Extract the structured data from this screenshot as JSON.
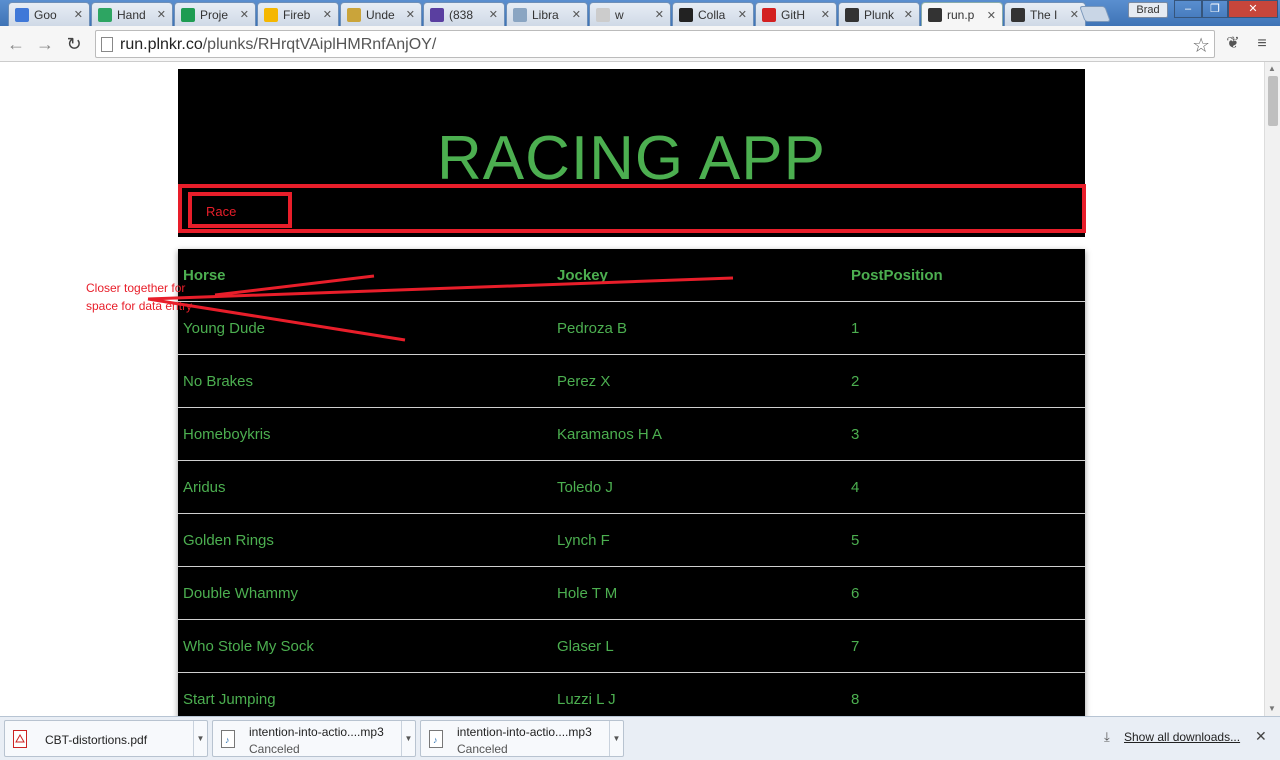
{
  "browser": {
    "tabs": [
      {
        "label": "Goo",
        "color": "#3f78d8"
      },
      {
        "label": "Hand",
        "color": "#2da562"
      },
      {
        "label": "Proje",
        "color": "#1e9c52"
      },
      {
        "label": "Fireb",
        "color": "#f5b700"
      },
      {
        "label": "Unde",
        "color": "#caa43a"
      },
      {
        "label": "(838",
        "color": "#5a3fa0"
      },
      {
        "label": "Libra",
        "color": "#8aa5c2"
      },
      {
        "label": "w",
        "color": "#cccccc"
      },
      {
        "label": "Colla",
        "color": "#222222"
      },
      {
        "label": "GitH",
        "color": "#d32020"
      },
      {
        "label": "Plunk",
        "color": "#333333"
      },
      {
        "label": "run.p",
        "color": "#333333"
      },
      {
        "label": "The I",
        "color": "#333333"
      }
    ],
    "user": "Brad",
    "url_host": "run.plnkr.co",
    "url_path": "/plunks/RHrqtVAiplHMRnfAnjOY/"
  },
  "page": {
    "title": "RACING APP",
    "nav": {
      "race_label": "Race"
    },
    "table": {
      "headers": [
        "Horse",
        "Jockey",
        "PostPosition"
      ],
      "rows": [
        [
          "Young Dude",
          "Pedroza B",
          "1"
        ],
        [
          "No Brakes",
          "Perez X",
          "2"
        ],
        [
          "Homeboykris",
          "Karamanos H A",
          "3"
        ],
        [
          "Aridus",
          "Toledo J",
          "4"
        ],
        [
          "Golden Rings",
          "Lynch F",
          "5"
        ],
        [
          "Double Whammy",
          "Hole T M",
          "6"
        ],
        [
          "Who Stole My Sock",
          "Glaser L",
          "7"
        ],
        [
          "Start Jumping",
          "Luzzi L J",
          "8"
        ]
      ]
    },
    "annotation": "Closer together for space for data entry"
  },
  "downloads": {
    "items": [
      {
        "name": "CBT-distortions.pdf",
        "status": ""
      },
      {
        "name": "intention-into-actio....mp3",
        "status": "Canceled"
      },
      {
        "name": "intention-into-actio....mp3",
        "status": "Canceled"
      }
    ],
    "show_all": "Show all downloads..."
  }
}
